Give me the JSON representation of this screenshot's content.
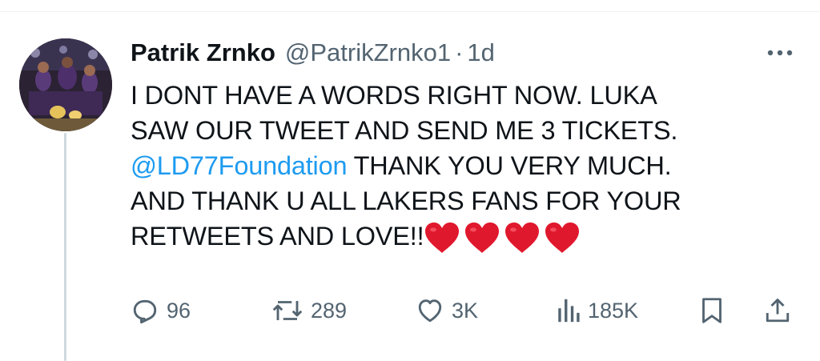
{
  "tweet": {
    "author_name": "Patrik Zrnko",
    "author_handle": "@PatrikZrnko1",
    "separator": "·",
    "time": "1d",
    "lines": {
      "l1": "I DONT HAVE A WORDS RIGHT NOW. LUKA",
      "l2": "SAW OUR TWEET AND SEND ME 3 TICKETS.",
      "l3_mention": "@LD77Foundation",
      "l3_rest": " THANK YOU VERY MUCH.",
      "l4": "AND THANK U ALL LAKERS FANS FOR YOUR",
      "l5": "RETWEETS AND LOVE!!"
    },
    "emoji": [
      "heart-emoji",
      "heart-emoji",
      "heart-emoji",
      "heart-emoji"
    ]
  },
  "actions": {
    "replies": "96",
    "retweets": "289",
    "likes": "3K",
    "views": "185K"
  },
  "icons": {
    "more": "more-icon",
    "reply": "reply-icon",
    "retweet": "retweet-icon",
    "like": "like-icon",
    "views": "views-icon",
    "bookmark": "bookmark-icon",
    "share": "share-icon"
  },
  "colors": {
    "link": "#1d9bf0",
    "secondary_text": "#536471",
    "primary_text": "#0f1419",
    "heart": "#e0182d"
  }
}
